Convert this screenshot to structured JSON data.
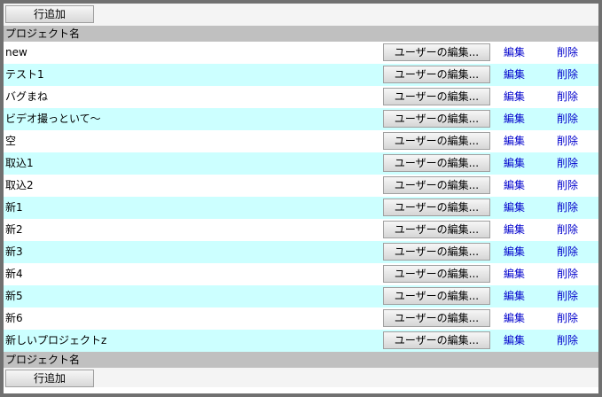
{
  "toolbar": {
    "add_row_label": "行追加"
  },
  "table": {
    "header_label": "プロジェクト名",
    "footer_label": "プロジェクト名",
    "user_edit_label": "ユーザーの編集...",
    "edit_label": "編集",
    "delete_label": "削除",
    "rows": [
      {
        "name": "new"
      },
      {
        "name": "テスト1"
      },
      {
        "name": "バグまね"
      },
      {
        "name": "ビデオ撮っといて〜"
      },
      {
        "name": "空"
      },
      {
        "name": "取込1"
      },
      {
        "name": "取込2"
      },
      {
        "name": "新1"
      },
      {
        "name": "新2"
      },
      {
        "name": "新3"
      },
      {
        "name": "新4"
      },
      {
        "name": "新5"
      },
      {
        "name": "新6"
      },
      {
        "name": "新しいプロジェクトz"
      }
    ]
  },
  "footer_toolbar": {
    "add_row_label": "行追加"
  },
  "colors": {
    "row_even": "#ffffff",
    "row_odd": "#ccffff",
    "header": "#c0c0c0",
    "link": "#0000cc"
  }
}
